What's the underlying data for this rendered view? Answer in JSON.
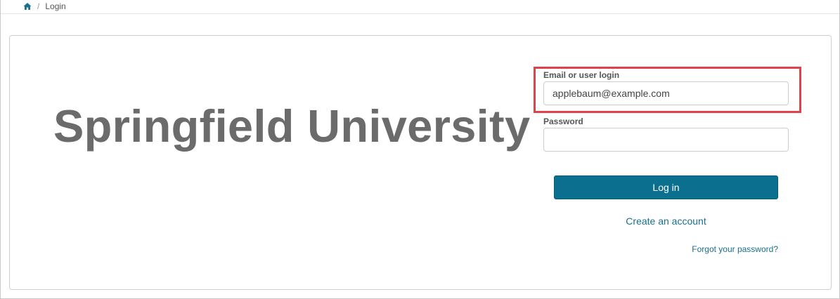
{
  "breadcrumb": {
    "home_icon": "home-icon",
    "separator": "/",
    "current": "Login"
  },
  "branding": {
    "title": "Springfield University"
  },
  "form": {
    "email_label": "Email or user login",
    "email_value": "applebaum@example.com",
    "password_label": "Password",
    "password_value": "",
    "login_button": "Log in",
    "create_account": "Create an account",
    "forgot_password": "Forgot your password?"
  },
  "colors": {
    "primary_button": "#0b708f",
    "link": "#196f8e",
    "highlight_border": "#e0424a",
    "brand_text": "#6b6b6b"
  }
}
